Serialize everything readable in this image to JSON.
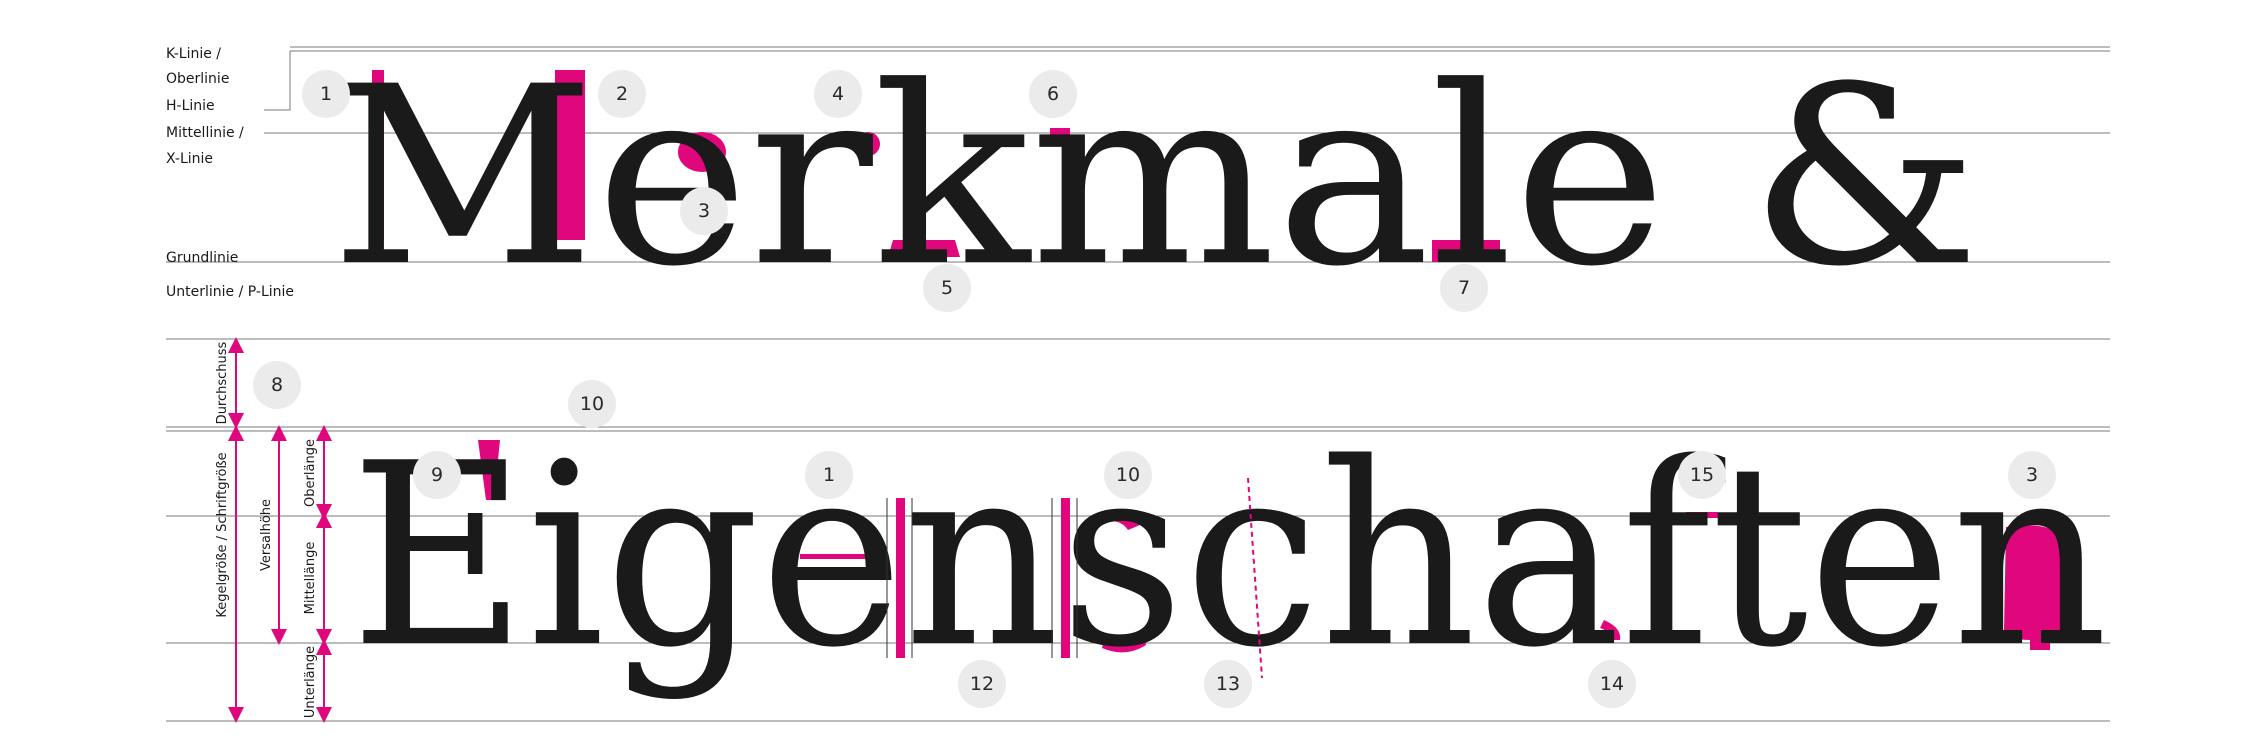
{
  "colors": {
    "accent": "#e0067c",
    "ink": "#1a1a1a",
    "badge": "#ebebeb",
    "line": "#7a7a7a"
  },
  "top": {
    "word": "Merkmale &",
    "guide_labels": {
      "k_linie": "K-Linie /",
      "oberlinie": "Oberlinie",
      "h_linie": "H-Linie",
      "mittellinie": "Mittellinie /",
      "x_linie": "X-Linie",
      "grundlinie": "Grundlinie",
      "unterlinie": "Unterlinie / P-Linie"
    },
    "badges": [
      "1",
      "2",
      "3",
      "4",
      "5",
      "6",
      "7"
    ]
  },
  "bottom": {
    "word": "Eigenschaften",
    "vertical_labels": {
      "durchschuss": "Durchschuss",
      "kegelgroesse": "Kegelgröße / Schriftgröße",
      "versalhoehe": "Versalhöhe",
      "oberlaenge": "Oberlänge",
      "mittellaenge": "Mittellänge",
      "unterlaenge": "Unterlänge"
    },
    "badges": [
      "8",
      "10",
      "9",
      "1",
      "10",
      "15",
      "3",
      "12",
      "13",
      "14"
    ]
  }
}
